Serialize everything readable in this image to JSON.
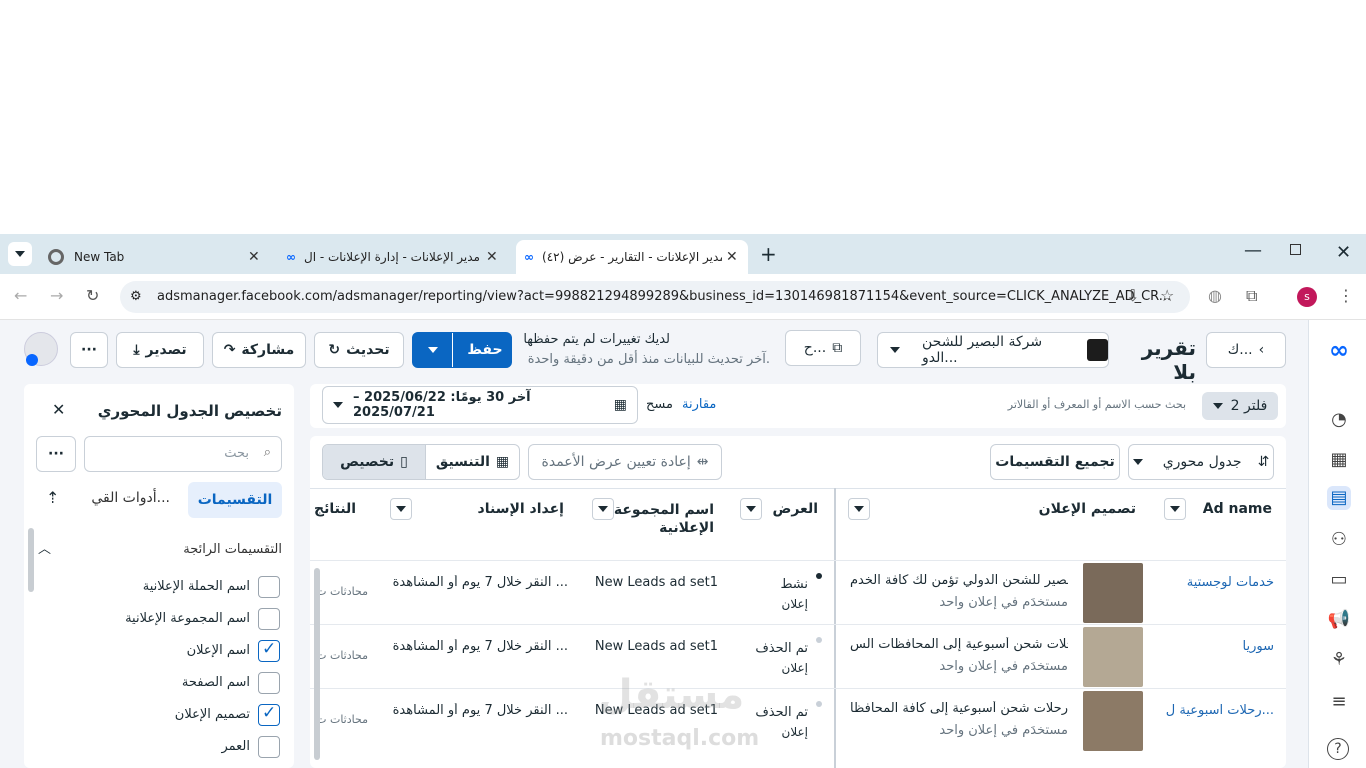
{
  "browser": {
    "tabs": [
      {
        "title": "New Tab",
        "active": false
      },
      {
        "title": "مدير الإعلانات - إدارة الإعلانات - ال",
        "active": false
      },
      {
        "title": "(٤٢) مدير الإعلانات - التقارير - عرض",
        "active": true
      }
    ],
    "url": "adsmanager.facebook.com/adsmanager/reporting/view?act=998821294899289&business_id=130146981871154&event_source=CLICK_ANALYZE_AD_CR...",
    "profile_initial": "s"
  },
  "header": {
    "report_title": "تقرير بلا",
    "breadcrumb_back": "ك...",
    "account_name": "شركة البصير للشحن الدو...",
    "view_selector": "ح...",
    "unsaved_title": "لديك تغييرات لم يتم حفظها",
    "unsaved_sub": "آخر تحديث للبيانات منذ أقل من دقيقة واحدة.",
    "save_label": "حفظ",
    "refresh_label": "تحديث",
    "share_label": "مشاركة",
    "export_label": "تصدير",
    "more_label": "···"
  },
  "filters": {
    "filter_count": "2 فلتر",
    "search_placeholder": "بحث حسب الاسم أو المعرف أو القالاتر",
    "compare_label": "مقارنة",
    "clear_label": "مسح",
    "date_range": "آخر 30 يومًا: 2025/06/22 – 2025/07/21"
  },
  "toolbar": {
    "view_type": "جدول محوري",
    "group_breakdowns": "تجميع التقسيمات",
    "reset_columns": "إعادة تعيين عرض الأعمدة",
    "format_label": "التنسيق",
    "customize_label": "تخصيص"
  },
  "columns": {
    "ad_name": "Ad name",
    "ad_creative": "تصميم الإعلان",
    "delivery": "العرض",
    "adset_name": "اسم المجموعة الإعلانية",
    "attribution": "إعداد الإسناد",
    "results": "النتائج"
  },
  "rows": [
    {
      "ad_name": "خدمات لوجستية",
      "creative_text": "البصير للشحن الدولي تؤمن لك كافة الخدم...",
      "creative_sub": "مستخدَم في إعلان واحد",
      "delivery": "نشط",
      "delivery_sub": "إعلان",
      "adset": "New Leads ad set1",
      "attribution": "النقر خلال 7 يوم أو المشاهدة ...",
      "results": "محادثات ت"
    },
    {
      "ad_name": "سوريا",
      "creative_text": "رحلات شحن أسبوعية إلى المحافظات الس...",
      "creative_sub": "مستخدَم في إعلان واحد",
      "delivery": "تم الحذف",
      "delivery_sub": "إعلان",
      "adset": "New Leads ad set1",
      "attribution": "النقر خلال 7 يوم أو المشاهدة ...",
      "results": "محادثات ت"
    },
    {
      "ad_name": "رحلات اسبوعية ل...",
      "creative_text": "رحلات شحن أسبوعية إلى كافة المحافظا...",
      "creative_sub": "مستخدَم في إعلان واحد",
      "delivery": "تم الحذف",
      "delivery_sub": "إعلان",
      "adset": "New Leads ad set1",
      "attribution": "النقر خلال 7 يوم أو المشاهدة ...",
      "results": "محادثات ت"
    }
  ],
  "side_panel": {
    "title": "تخصيص الجدول المحوري",
    "search_placeholder": "بحث",
    "tab_breakdowns": "التقسيمات",
    "tab_tools": "أدوات القي...",
    "section_title": "التقسيمات الرائجة",
    "items": [
      {
        "label": "اسم الحملة الإعلانية",
        "checked": false
      },
      {
        "label": "اسم المجموعة الإعلانية",
        "checked": false
      },
      {
        "label": "اسم الإعلان",
        "checked": true
      },
      {
        "label": "اسم الصفحة",
        "checked": false
      },
      {
        "label": "تصميم الإعلان",
        "checked": true
      },
      {
        "label": "العمر",
        "checked": false
      }
    ]
  },
  "watermark": {
    "text_ar": "مستقل",
    "text_en": "mostaql.com"
  },
  "colors": {
    "accent": "#0a66c2",
    "tabbar": "#dbe8ef",
    "link": "#1d67b3"
  }
}
